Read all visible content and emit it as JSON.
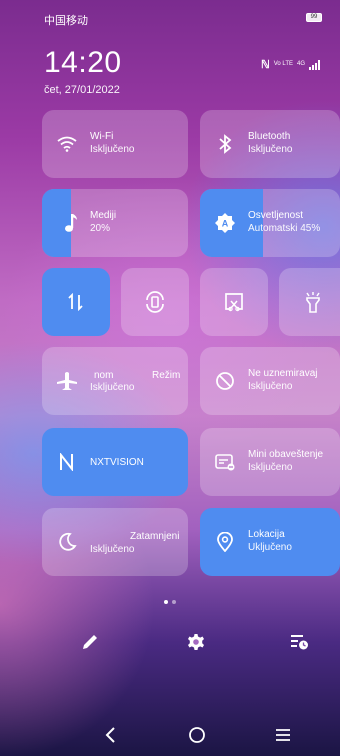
{
  "status": {
    "carrier": "中国移动",
    "battery": "99",
    "volte": "Vo LTE",
    "net": "4G"
  },
  "clock": {
    "time": "14:20",
    "date": "čet, 27/01/2022"
  },
  "tiles": {
    "wifi": {
      "title": "Wi-Fi",
      "state": "Isključeno"
    },
    "bluetooth": {
      "title": "Bluetooth",
      "state": "Isključeno"
    },
    "media": {
      "title": "Mediji",
      "value": "20%",
      "level": 0.2
    },
    "brightness": {
      "title": "Osvetljenost",
      "value": "Automatski 45%",
      "level": 0.45
    },
    "airplane": {
      "title_a": "nom",
      "title_b": "Režim",
      "state": "Isključeno"
    },
    "dnd": {
      "title": "Ne uznemiravaj",
      "state": "Isključeno"
    },
    "nxt": {
      "title": "NXTVISION"
    },
    "mini": {
      "title": "Mini obaveštenje",
      "state": "Isključeno"
    },
    "dark": {
      "title": "Zatamnjeni",
      "state": "Isključeno"
    },
    "location": {
      "title": "Lokacija",
      "state": "Uključeno"
    }
  },
  "colors": {
    "accent": "#4f8cf0"
  },
  "icons": [
    "wifi-icon",
    "bluetooth-icon",
    "music-icon",
    "brightness-icon",
    "data-icon",
    "rotate-icon",
    "screenshot-icon",
    "flashlight-icon",
    "airplane-icon",
    "dnd-icon",
    "nfc-icon",
    "notification-icon",
    "moon-icon",
    "location-icon",
    "edit-icon",
    "gear-icon",
    "sort-icon",
    "back-icon",
    "home-icon",
    "menu-icon"
  ],
  "pager": {
    "pages": 2,
    "current": 1
  }
}
